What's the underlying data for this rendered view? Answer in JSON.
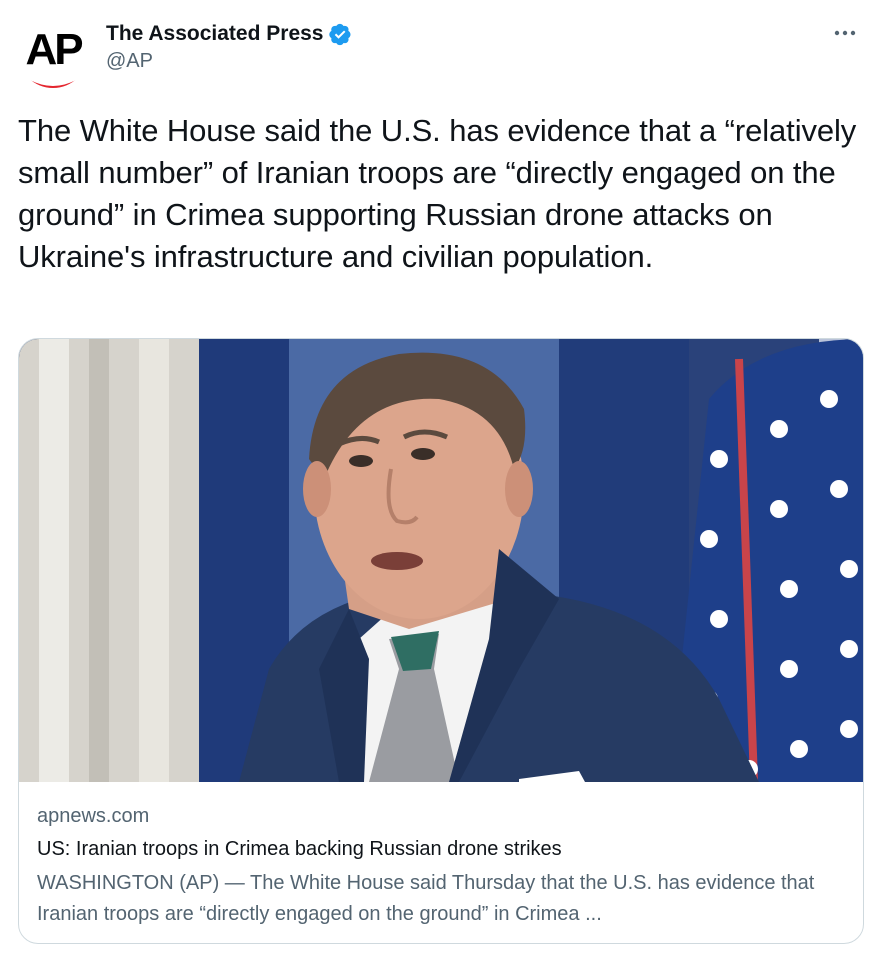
{
  "author": {
    "display_name": "The Associated Press",
    "handle": "@AP",
    "avatar_text": "AP",
    "verified": true
  },
  "tweet": {
    "text": "The White House said the U.S. has evidence that a “relatively small number” of Iranian troops are “directly engaged on the ground” in Crimea supporting Russian drone attacks on Ukraine's infrastructure and civilian population."
  },
  "card": {
    "domain": "apnews.com",
    "title": "US: Iranian troops in Crimea backing Russian drone strikes",
    "description": "WASHINGTON (AP) — The White House said Thursday that the U.S. has evidence that Iranian troops are “directly engaged on the ground” in Crimea ..."
  },
  "icons": {
    "verified": "verified-badge-icon",
    "more": "more-options-icon"
  },
  "colors": {
    "verified_blue": "#1d9bf0",
    "ap_red": "#e4262f",
    "secondary_text": "#536471"
  }
}
